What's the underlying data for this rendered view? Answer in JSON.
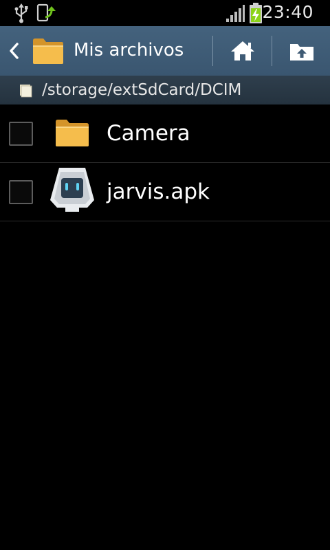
{
  "status_bar": {
    "time": "23:40",
    "icons": [
      "usb-icon",
      "screen-rotate-icon",
      "signal-icon",
      "battery-charging-icon"
    ]
  },
  "action_bar": {
    "title": "Mis archivos",
    "icons": [
      "back-arrow-icon",
      "folder-icon",
      "home-icon",
      "up-folder-icon"
    ]
  },
  "path_bar": {
    "path": "/storage/extSdCard/DCIM",
    "icon": "sd-card-icon"
  },
  "files": [
    {
      "name": "Camera",
      "icon": "folder-icon"
    },
    {
      "name": "jarvis.apk",
      "icon": "apk-app-icon"
    }
  ],
  "colors": {
    "action_bar": "#3e5a74",
    "path_bar": "#2a3845",
    "folder": "#f2b543",
    "battery": "#8cd319",
    "background": "#000000"
  }
}
